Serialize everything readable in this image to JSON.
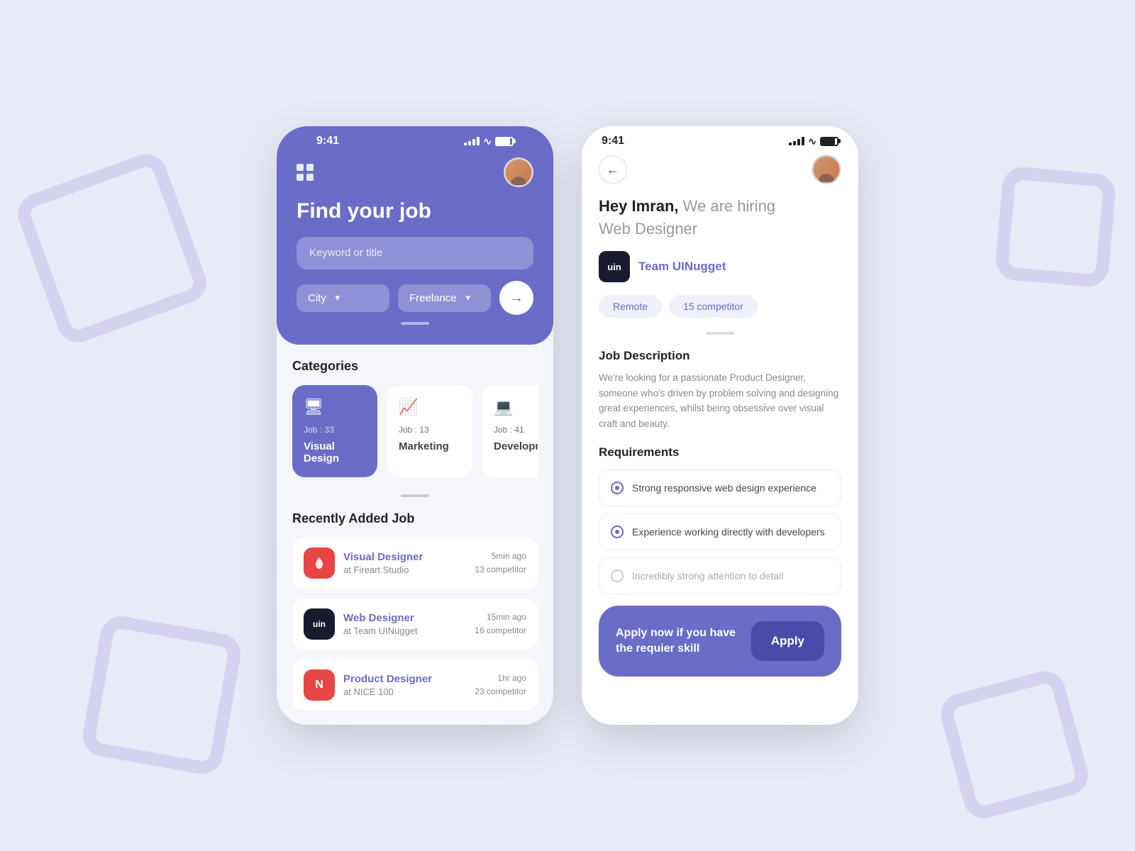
{
  "background": {
    "color": "#e8eaf6"
  },
  "phone1": {
    "status": {
      "time": "9:41",
      "signal_bars": [
        3,
        5,
        7,
        9,
        11
      ],
      "wifi": "wifi",
      "battery": "battery"
    },
    "header": {
      "title": "Find your job",
      "search_placeholder": "Keyword or title",
      "city_label": "City",
      "freelance_label": "Freelance"
    },
    "categories": {
      "section_title": "Categories",
      "items": [
        {
          "job_count": "Job : 33",
          "name": "Visual Design",
          "active": true
        },
        {
          "job_count": "Job : 13",
          "name": "Marketing",
          "active": false
        },
        {
          "job_count": "Job : 41",
          "name": "Development",
          "active": false
        }
      ]
    },
    "recent_jobs": {
      "section_title": "Recently Added Job",
      "items": [
        {
          "title": "Visual Designer",
          "company": "at Fireart Studio",
          "time": "5min ago",
          "competitors": "13 competitor",
          "logo_text": "",
          "logo_color": "red"
        },
        {
          "title": "Web Designer",
          "company": "at Team UINugget",
          "time": "15min ago",
          "competitors": "16 competitor",
          "logo_text": "uin",
          "logo_color": "dark"
        },
        {
          "title": "Product Designer",
          "company": "at NICE 100",
          "time": "1hr ago",
          "competitors": "23 competitor",
          "logo_text": "N",
          "logo_color": "pink"
        }
      ]
    }
  },
  "phone2": {
    "status": {
      "time": "9:41"
    },
    "greeting": {
      "hey": "Hey Imran,",
      "rest": " We are hiring",
      "position": "Web Designer"
    },
    "company": {
      "logo_text": "uin",
      "name": "Team UINugget"
    },
    "tags": [
      {
        "label": "Remote"
      },
      {
        "label": "15 competitor"
      }
    ],
    "job_description": {
      "title": "Job Description",
      "text": "We're looking for a passionate Product Designer, someone who's driven by problem solving and designing great experiences, whilst being obsessive over visual craft and beauty."
    },
    "requirements": {
      "title": "Requirements",
      "items": [
        {
          "text": "Strong responsive web design experience",
          "filled": true
        },
        {
          "text": "Experience working directly with developers",
          "filled": true
        },
        {
          "text": "Incredibly strong attention to detail",
          "filled": false,
          "muted": true
        }
      ]
    },
    "apply_bar": {
      "label_line1": "Apply now if you have",
      "label_line2": "the requier skill",
      "button_label": "Apply"
    }
  }
}
